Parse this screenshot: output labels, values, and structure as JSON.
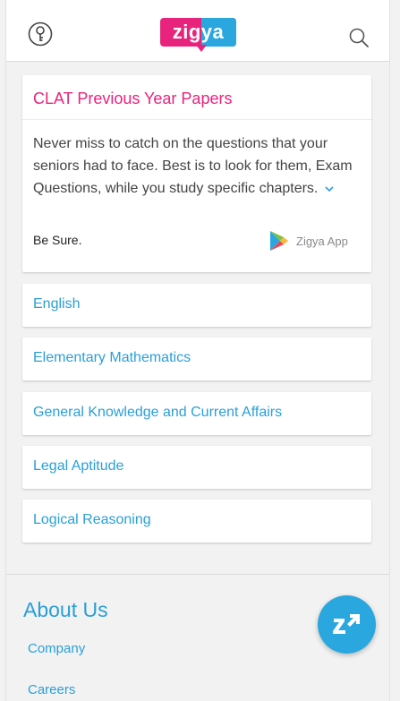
{
  "header": {
    "logo_text": "zigya",
    "brand_pink": "#e8237d",
    "brand_blue": "#2aa7df"
  },
  "intro": {
    "title": "CLAT Previous Year Papers",
    "text": "Never miss to catch on the questions that your seniors had to face. Best is to look for them, Exam Questions, while you study specific chapters.",
    "footer": "Be Sure.",
    "app_label": "Zigya App"
  },
  "subjects": [
    {
      "label": "English"
    },
    {
      "label": "Elementary Mathematics"
    },
    {
      "label": "General Knowledge and Current Affairs"
    },
    {
      "label": "Legal Aptitude"
    },
    {
      "label": "Logical Reasoning"
    }
  ],
  "footer": {
    "about_title": "About Us",
    "links": [
      {
        "label": "Company"
      },
      {
        "label": "Careers"
      }
    ]
  }
}
